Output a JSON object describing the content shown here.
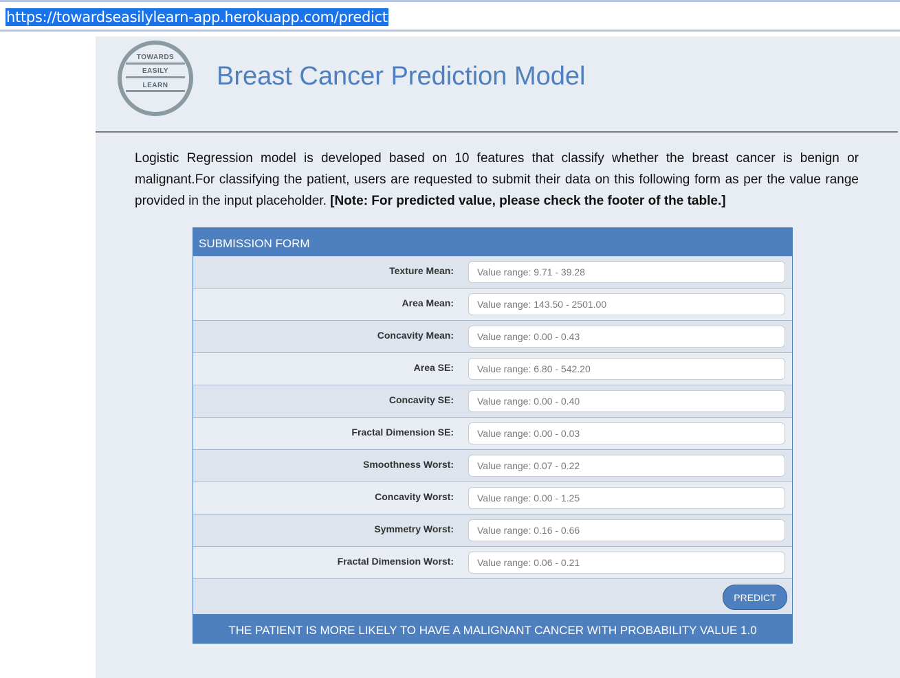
{
  "browser": {
    "url": "https://towardseasilylearn-app.herokuapp.com/predict"
  },
  "logo": {
    "words": [
      "TOWARDS",
      "EASILY",
      "LEARN"
    ]
  },
  "header": {
    "title": "Breast Cancer Prediction Model"
  },
  "description": {
    "text": "Logistic Regression model is developed based on 10 features that classify whether the breast cancer is benign or malignant.For classifying the patient, users are requested to submit their data on this following form as per the value range provided in the input placeholder. ",
    "note": "[Note: For predicted value, please check the footer of the table.]"
  },
  "form": {
    "title": "SUBMISSION FORM",
    "fields": [
      {
        "label": "Texture Mean:",
        "placeholder": "Value range: 9.71 - 39.28",
        "value": ""
      },
      {
        "label": "Area Mean:",
        "placeholder": "Value range: 143.50 - 2501.00",
        "value": ""
      },
      {
        "label": "Concavity Mean:",
        "placeholder": "Value range: 0.00 - 0.43",
        "value": ""
      },
      {
        "label": "Area SE:",
        "placeholder": "Value range: 6.80 - 542.20",
        "value": ""
      },
      {
        "label": "Concavity SE:",
        "placeholder": "Value range: 0.00 - 0.40",
        "value": ""
      },
      {
        "label": "Fractal Dimension SE:",
        "placeholder": "Value range: 0.00 - 0.03",
        "value": ""
      },
      {
        "label": "Smoothness Worst:",
        "placeholder": "Value range: 0.07 - 0.22",
        "value": ""
      },
      {
        "label": "Concavity Worst:",
        "placeholder": "Value range: 0.00 - 1.25",
        "value": ""
      },
      {
        "label": "Symmetry Worst:",
        "placeholder": "Value range: 0.16 - 0.66",
        "value": ""
      },
      {
        "label": "Fractal Dimension Worst:",
        "placeholder": "Value range: 0.06 - 0.21",
        "value": ""
      }
    ],
    "submit_label": "PREDICT",
    "result": "THE PATIENT IS MORE LIKELY TO HAVE A MALIGNANT CANCER WITH PROBABILITY VALUE 1.0"
  },
  "colors": {
    "accent": "#4e7fbf",
    "page_bg": "#e8edf4",
    "url_highlight": "#1a73e8"
  }
}
